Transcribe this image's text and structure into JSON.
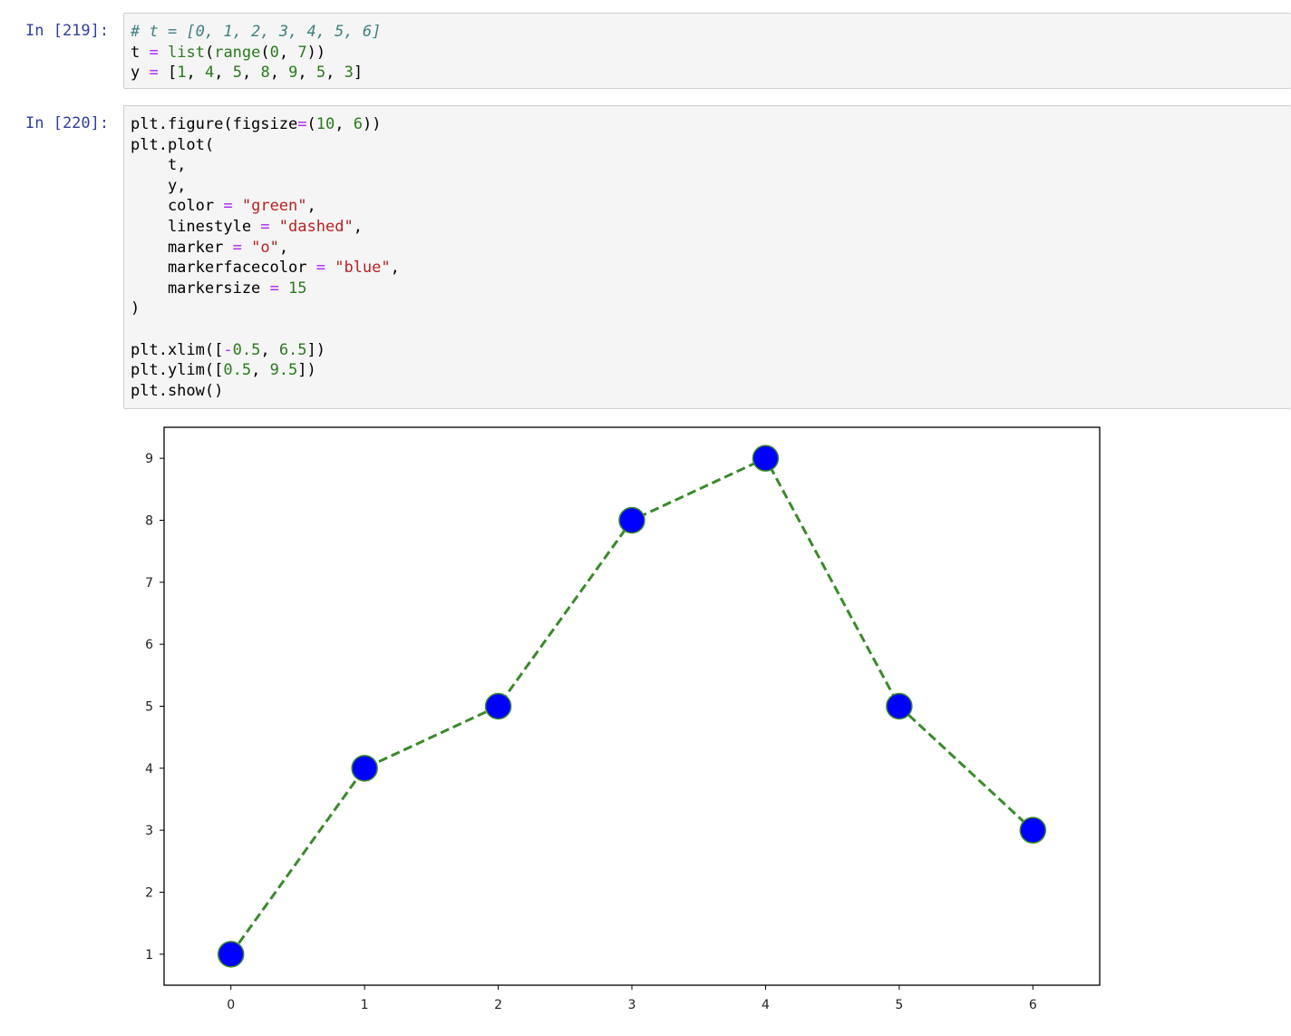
{
  "cells": [
    {
      "prompt": "In [219]:",
      "lines": [
        [
          {
            "t": "# t = [0, 1, 2, 3, 4, 5, 6]",
            "c": "comment"
          }
        ],
        [
          {
            "t": "t",
            "c": "name"
          },
          {
            "t": " ",
            "c": "punc"
          },
          {
            "t": "=",
            "c": "op"
          },
          {
            "t": " ",
            "c": "punc"
          },
          {
            "t": "list",
            "c": "builtin"
          },
          {
            "t": "(",
            "c": "punc"
          },
          {
            "t": "range",
            "c": "builtin"
          },
          {
            "t": "(",
            "c": "punc"
          },
          {
            "t": "0",
            "c": "num"
          },
          {
            "t": ", ",
            "c": "punc"
          },
          {
            "t": "7",
            "c": "num"
          },
          {
            "t": "))",
            "c": "punc"
          }
        ],
        [
          {
            "t": "y",
            "c": "name"
          },
          {
            "t": " ",
            "c": "punc"
          },
          {
            "t": "=",
            "c": "op"
          },
          {
            "t": " [",
            "c": "punc"
          },
          {
            "t": "1",
            "c": "num"
          },
          {
            "t": ", ",
            "c": "punc"
          },
          {
            "t": "4",
            "c": "num"
          },
          {
            "t": ", ",
            "c": "punc"
          },
          {
            "t": "5",
            "c": "num"
          },
          {
            "t": ", ",
            "c": "punc"
          },
          {
            "t": "8",
            "c": "num"
          },
          {
            "t": ", ",
            "c": "punc"
          },
          {
            "t": "9",
            "c": "num"
          },
          {
            "t": ", ",
            "c": "punc"
          },
          {
            "t": "5",
            "c": "num"
          },
          {
            "t": ", ",
            "c": "punc"
          },
          {
            "t": "3",
            "c": "num"
          },
          {
            "t": "]",
            "c": "punc"
          }
        ]
      ]
    },
    {
      "prompt": "In [220]:",
      "lines": [
        [
          {
            "t": "plt.figure(figsize",
            "c": "name"
          },
          {
            "t": "=",
            "c": "op"
          },
          {
            "t": "(",
            "c": "punc"
          },
          {
            "t": "10",
            "c": "num"
          },
          {
            "t": ", ",
            "c": "punc"
          },
          {
            "t": "6",
            "c": "num"
          },
          {
            "t": "))",
            "c": "punc"
          }
        ],
        [
          {
            "t": "plt.plot(",
            "c": "name"
          }
        ],
        [
          {
            "t": "    t,",
            "c": "name"
          }
        ],
        [
          {
            "t": "    y,",
            "c": "name"
          }
        ],
        [
          {
            "t": "    color ",
            "c": "name"
          },
          {
            "t": "=",
            "c": "op"
          },
          {
            "t": " ",
            "c": "punc"
          },
          {
            "t": "\"green\"",
            "c": "str"
          },
          {
            "t": ",",
            "c": "punc"
          }
        ],
        [
          {
            "t": "    linestyle ",
            "c": "name"
          },
          {
            "t": "=",
            "c": "op"
          },
          {
            "t": " ",
            "c": "punc"
          },
          {
            "t": "\"dashed\"",
            "c": "str"
          },
          {
            "t": ",",
            "c": "punc"
          }
        ],
        [
          {
            "t": "    marker ",
            "c": "name"
          },
          {
            "t": "=",
            "c": "op"
          },
          {
            "t": " ",
            "c": "punc"
          },
          {
            "t": "\"o\"",
            "c": "str"
          },
          {
            "t": ",",
            "c": "punc"
          }
        ],
        [
          {
            "t": "    markerfacecolor ",
            "c": "name"
          },
          {
            "t": "=",
            "c": "op"
          },
          {
            "t": " ",
            "c": "punc"
          },
          {
            "t": "\"blue\"",
            "c": "str"
          },
          {
            "t": ",",
            "c": "punc"
          }
        ],
        [
          {
            "t": "    markersize ",
            "c": "name"
          },
          {
            "t": "=",
            "c": "op"
          },
          {
            "t": " ",
            "c": "punc"
          },
          {
            "t": "15",
            "c": "num"
          }
        ],
        [
          {
            "t": ")",
            "c": "punc"
          }
        ],
        [
          {
            "t": "",
            "c": "punc"
          }
        ],
        [
          {
            "t": "plt.xlim([",
            "c": "name"
          },
          {
            "t": "-",
            "c": "op"
          },
          {
            "t": "0.5",
            "c": "num"
          },
          {
            "t": ", ",
            "c": "punc"
          },
          {
            "t": "6.5",
            "c": "num"
          },
          {
            "t": "])",
            "c": "punc"
          }
        ],
        [
          {
            "t": "plt.ylim([",
            "c": "name"
          },
          {
            "t": "0.5",
            "c": "num"
          },
          {
            "t": ", ",
            "c": "punc"
          },
          {
            "t": "9.5",
            "c": "num"
          },
          {
            "t": "])",
            "c": "punc"
          }
        ],
        [
          {
            "t": "plt.show()",
            "c": "name"
          }
        ]
      ]
    }
  ],
  "chart_data": {
    "type": "line",
    "x": [
      0,
      1,
      2,
      3,
      4,
      5,
      6
    ],
    "series": [
      {
        "values": [
          1,
          4,
          5,
          8,
          9,
          5,
          3
        ]
      }
    ],
    "xlim": [
      -0.5,
      6.5
    ],
    "ylim": [
      0.5,
      9.5
    ],
    "xticks": [
      "0",
      "1",
      "2",
      "3",
      "4",
      "5",
      "6"
    ],
    "yticks": [
      "1",
      "2",
      "3",
      "4",
      "5",
      "6",
      "7",
      "8",
      "9"
    ],
    "line_color": "#3a8a2a",
    "linestyle": "dashed",
    "marker": "o",
    "marker_face_color": "#0000ff",
    "marker_edge_color": "#3a8a2a",
    "grid": false
  }
}
